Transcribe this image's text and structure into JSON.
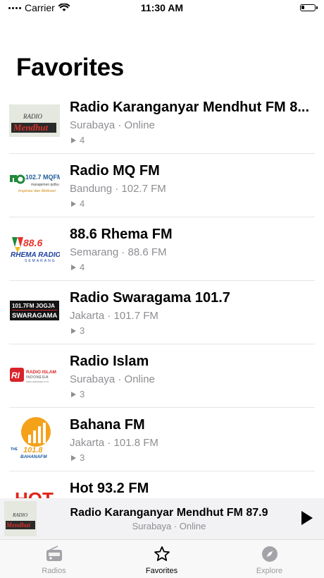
{
  "status_bar": {
    "carrier": "Carrier",
    "time": "11:30 AM"
  },
  "page": {
    "title": "Favorites"
  },
  "stations": [
    {
      "name": "Radio Karanganyar Mendhut FM 8...",
      "meta": "Surabaya · Online",
      "plays": "4",
      "logo": "radio-mendhut-logo"
    },
    {
      "name": "Radio MQ FM",
      "meta": "Bandung · 102.7 FM",
      "plays": "4",
      "logo": "mqfm-logo"
    },
    {
      "name": "88.6 Rhema FM",
      "meta": "Semarang · 88.6 FM",
      "plays": "4",
      "logo": "rhema-radio-logo"
    },
    {
      "name": "Radio Swaragama 101.7",
      "meta": "Jakarta · 101.7 FM",
      "plays": "3",
      "logo": "swaragama-logo"
    },
    {
      "name": "Radio Islam",
      "meta": "Surabaya · Online",
      "plays": "3",
      "logo": "radio-islam-logo"
    },
    {
      "name": "Bahana FM",
      "meta": "Jakarta · 101.8 FM",
      "plays": "3",
      "logo": "bahana-fm-logo"
    },
    {
      "name": "Hot 93.2 FM",
      "meta": "",
      "plays": "",
      "logo": "hot-fm-logo"
    }
  ],
  "logo_texts": {
    "mendhut_radio": "RADIO",
    "mendhut": "Mendhut",
    "mq_freq": "102.7 MQFM",
    "mq_sub": "manajemen qolbu",
    "mq_tag": "Inspirasi dan Motivasi",
    "rhema_freq": "88.6",
    "rhema_radio": "RHEMA RADIO",
    "rhema_city": "SEMARANG",
    "swaragama_top": "101.7FM JOGJA",
    "swaragama": "SWARAGAMA",
    "islam_title": "RADIO ISLAM",
    "islam_sub": "INDONESIA",
    "islam_url": "www.radioislam.or.id",
    "bahana_the": "THE",
    "bahana_freq": "101.8",
    "bahana_name": "BAHANAFM",
    "hot": "HOT"
  },
  "mini_player": {
    "title": "Radio Karanganyar Mendhut FM 87.9",
    "subtitle": "Surabaya · Online"
  },
  "tabs": [
    {
      "label": "Radios",
      "icon": "radio-icon"
    },
    {
      "label": "Favorites",
      "icon": "star-icon"
    },
    {
      "label": "Explore",
      "icon": "compass-icon"
    }
  ],
  "colors": {
    "accent": "#000000",
    "secondary_text": "#8e8e93",
    "divider": "#e5e5ea",
    "mini_player_bg": "#f2f2f5"
  }
}
